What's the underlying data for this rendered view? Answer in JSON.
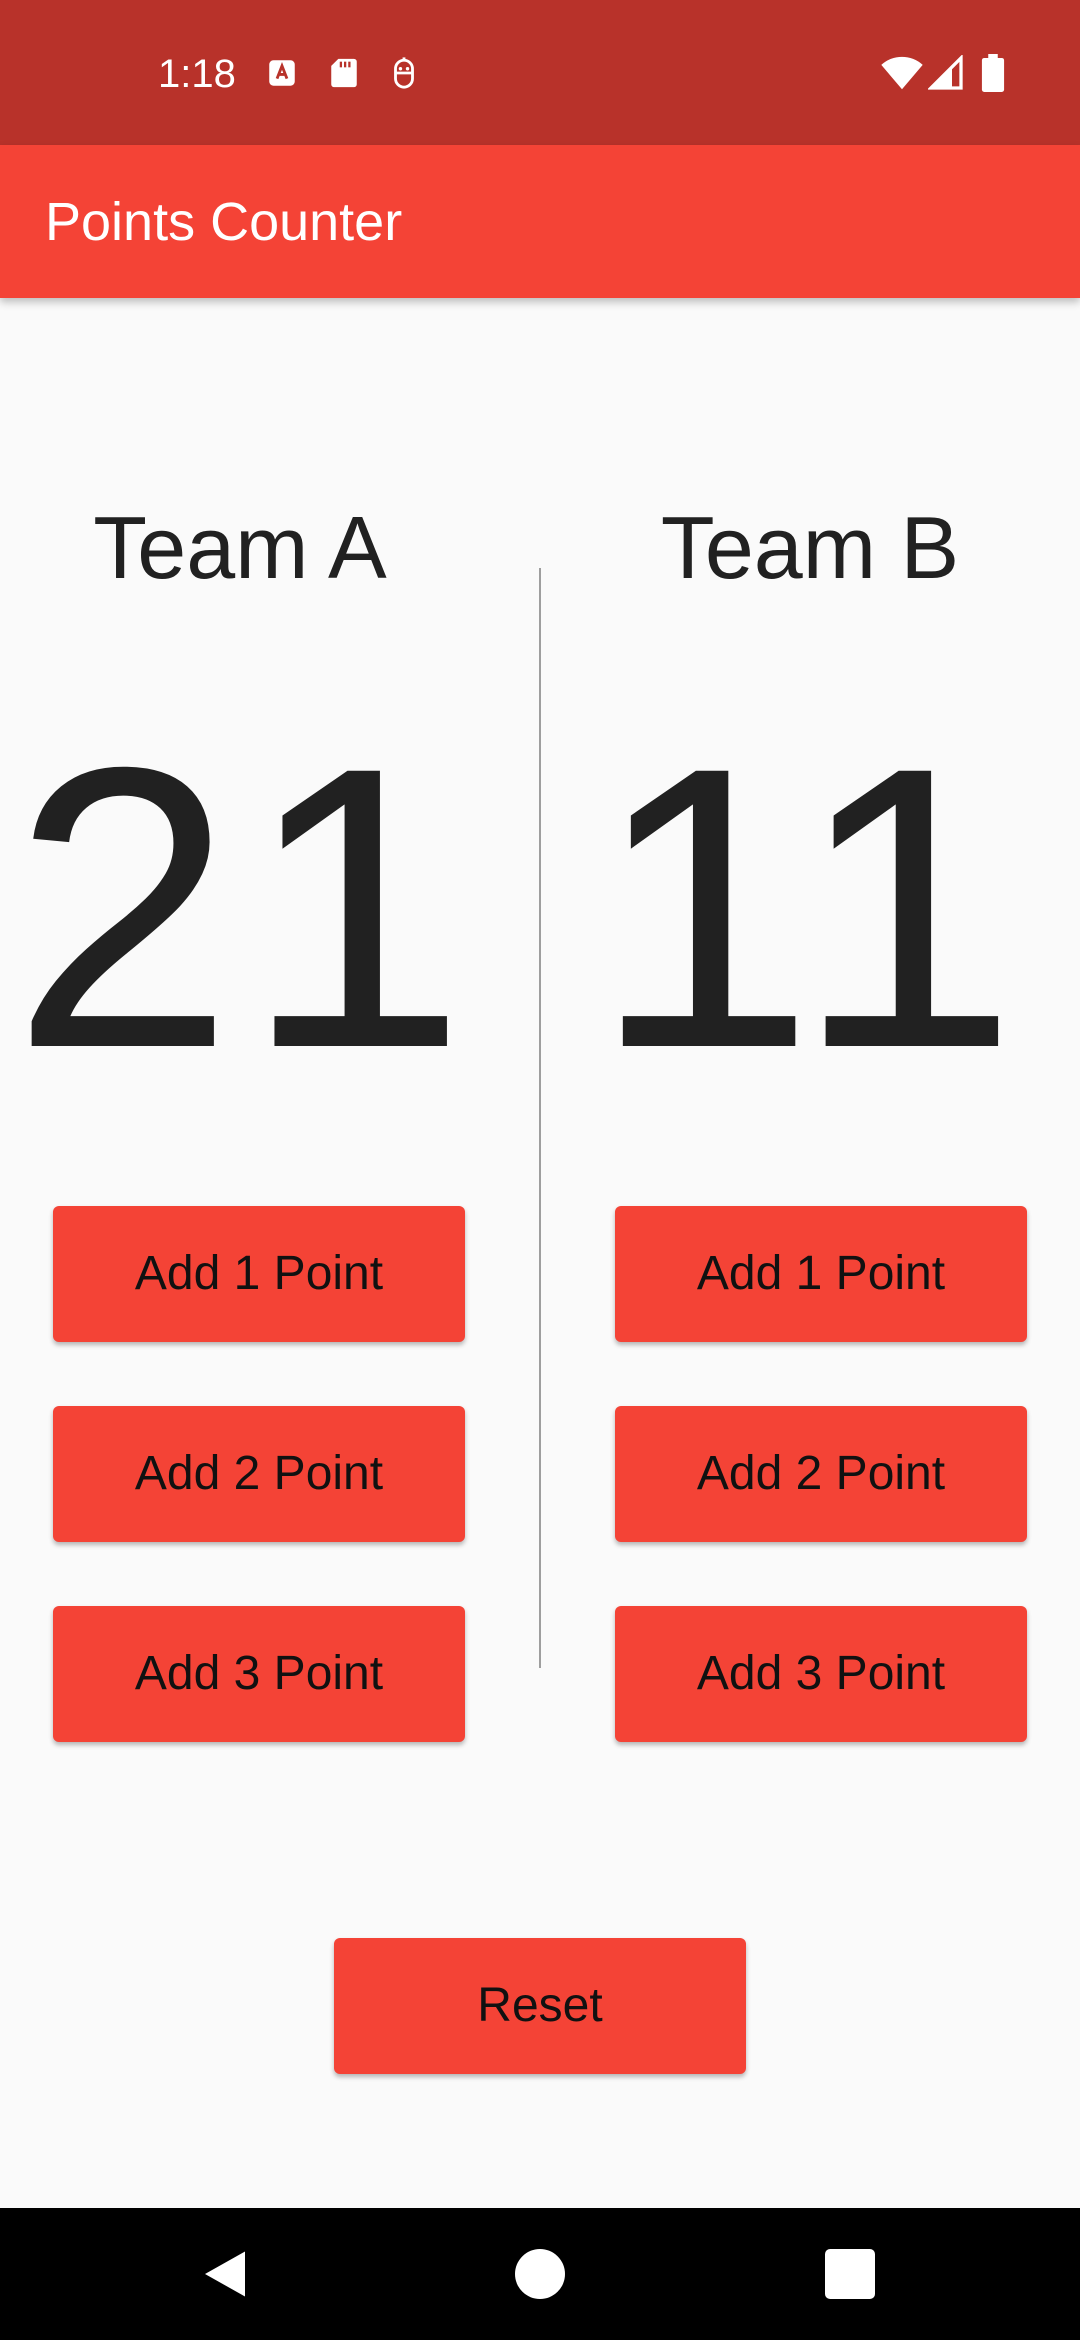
{
  "status_bar": {
    "time": "1:18",
    "icons_left": [
      "autofill-icon",
      "sd-card-icon",
      "robot-face-icon"
    ],
    "icons_right": [
      "wifi-icon",
      "cell-signal-icon",
      "battery-icon"
    ]
  },
  "app_bar": {
    "title": "Points Counter"
  },
  "team_a": {
    "name": "Team A",
    "score": "21",
    "buttons": [
      "Add 1 Point",
      "Add 2 Point",
      "Add 3 Point"
    ]
  },
  "team_b": {
    "name": "Team B",
    "score": "11",
    "buttons": [
      "Add 1 Point",
      "Add 2 Point",
      "Add 3 Point"
    ]
  },
  "reset_label": "Reset",
  "nav_bar": {
    "buttons": [
      "back-icon",
      "home-icon",
      "recents-icon"
    ]
  },
  "colors": {
    "status_bar": "#B8322A",
    "app_bar": "#F44336",
    "button": "#F44336",
    "background": "#FAFAFA"
  }
}
